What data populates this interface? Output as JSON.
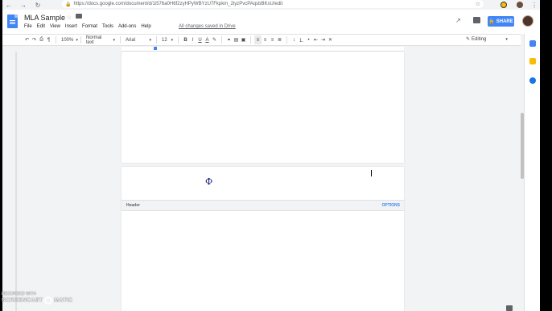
{
  "browser": {
    "url": "https://docs.google.com/document/d/1i576a0H6f2zyHPyWBYzU7Fkpkm_2iyzPvcPAqsbBKsU/edit"
  },
  "doc": {
    "title": "MLA Sample",
    "save_status": "All changes saved in Drive"
  },
  "menu": [
    "File",
    "Edit",
    "View",
    "Insert",
    "Format",
    "Tools",
    "Add-ons",
    "Help"
  ],
  "share": {
    "label": "SHARE"
  },
  "toolbar": {
    "zoom": "100%",
    "style": "Normal text",
    "font": "Arial",
    "size": "12",
    "mode": "Editing"
  },
  "header_bar": {
    "label": "Header",
    "options": "OPTIONS"
  },
  "watermark": {
    "line1": "RECORDED WITH",
    "line2a": "SCREENCAST",
    "line2b": "MATIC"
  },
  "colors": {
    "accent": "#4285f4",
    "keep": "#fbbc04",
    "tasks": "#1a73e8"
  },
  "icons": [
    "back-icon",
    "forward-icon",
    "reload-icon",
    "lock-icon",
    "star-icon",
    "folder-icon",
    "trend-icon",
    "comment-icon",
    "undo-icon",
    "redo-icon",
    "print-icon",
    "paint-format-icon",
    "bold-icon",
    "italic-icon",
    "underline-icon",
    "text-color-icon",
    "highlight-icon",
    "link-icon",
    "comment-add-icon",
    "image-icon",
    "align-left-icon",
    "align-center-icon",
    "align-right-icon",
    "justify-icon",
    "line-spacing-icon",
    "numbered-list-icon",
    "bulleted-list-icon",
    "indent-decrease-icon",
    "indent-increase-icon",
    "clear-format-icon",
    "pencil-icon"
  ]
}
